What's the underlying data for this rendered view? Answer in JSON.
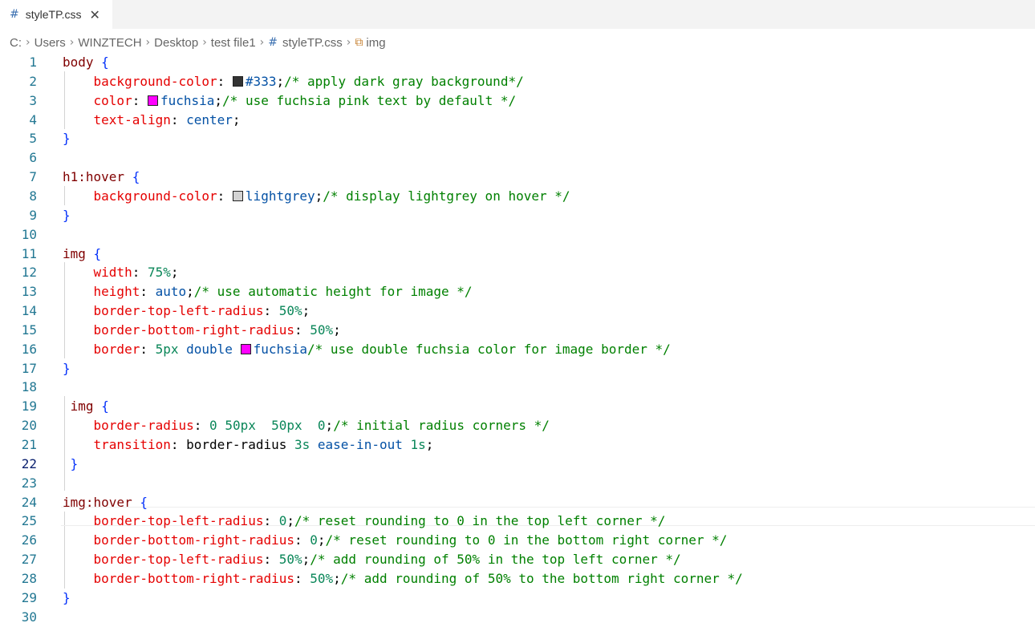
{
  "tab": {
    "icon": "css-hash-icon",
    "label": "styleTP.css"
  },
  "breadcrumb": {
    "items": [
      "C:",
      "Users",
      "WINZTECH",
      "Desktop",
      "test file1",
      "styleTP.css",
      "img"
    ]
  },
  "editor": {
    "active_line": 22,
    "lines": [
      {
        "n": "1",
        "t": [
          [
            "sel",
            "body"
          ],
          [
            "pn",
            " "
          ],
          [
            "br",
            "{"
          ]
        ]
      },
      {
        "n": "2",
        "t": [
          [
            "pn",
            "    "
          ],
          [
            "prop",
            "background-color"
          ],
          [
            "pn",
            ": "
          ],
          [
            "sw",
            "#333333"
          ],
          [
            "val",
            "#333"
          ],
          [
            "pn",
            ";"
          ],
          [
            "cm",
            "/* apply dark gray background*/"
          ]
        ]
      },
      {
        "n": "3",
        "t": [
          [
            "pn",
            "    "
          ],
          [
            "prop",
            "color"
          ],
          [
            "pn",
            ": "
          ],
          [
            "sw",
            "#ff00ff"
          ],
          [
            "val",
            "fuchsia"
          ],
          [
            "pn",
            ";"
          ],
          [
            "cm",
            "/* use fuchsia pink text by default */"
          ]
        ]
      },
      {
        "n": "4",
        "t": [
          [
            "pn",
            "    "
          ],
          [
            "prop",
            "text-align"
          ],
          [
            "pn",
            ": "
          ],
          [
            "val",
            "center"
          ],
          [
            "pn",
            ";"
          ]
        ]
      },
      {
        "n": "5",
        "t": [
          [
            "br",
            "}"
          ]
        ]
      },
      {
        "n": "6",
        "t": []
      },
      {
        "n": "7",
        "t": [
          [
            "sel",
            "h1:hover"
          ],
          [
            "pn",
            " "
          ],
          [
            "br",
            "{"
          ]
        ]
      },
      {
        "n": "8",
        "t": [
          [
            "pn",
            "    "
          ],
          [
            "prop",
            "background-color"
          ],
          [
            "pn",
            ": "
          ],
          [
            "sw",
            "#d3d3d3"
          ],
          [
            "val",
            "lightgrey"
          ],
          [
            "pn",
            ";"
          ],
          [
            "cm",
            "/* display lightgrey on hover */"
          ]
        ]
      },
      {
        "n": "9",
        "t": [
          [
            "br",
            "}"
          ]
        ]
      },
      {
        "n": "10",
        "t": []
      },
      {
        "n": "11",
        "t": [
          [
            "sel",
            "img"
          ],
          [
            "pn",
            " "
          ],
          [
            "br",
            "{"
          ]
        ]
      },
      {
        "n": "12",
        "t": [
          [
            "pn",
            "    "
          ],
          [
            "prop",
            "width"
          ],
          [
            "pn",
            ": "
          ],
          [
            "num",
            "75%"
          ],
          [
            "pn",
            ";"
          ]
        ]
      },
      {
        "n": "13",
        "t": [
          [
            "pn",
            "    "
          ],
          [
            "prop",
            "height"
          ],
          [
            "pn",
            ": "
          ],
          [
            "val",
            "auto"
          ],
          [
            "pn",
            ";"
          ],
          [
            "cm",
            "/* use automatic height for image */"
          ]
        ]
      },
      {
        "n": "14",
        "t": [
          [
            "pn",
            "    "
          ],
          [
            "prop",
            "border-top-left-radius"
          ],
          [
            "pn",
            ": "
          ],
          [
            "num",
            "50%"
          ],
          [
            "pn",
            ";"
          ]
        ]
      },
      {
        "n": "15",
        "t": [
          [
            "pn",
            "    "
          ],
          [
            "prop",
            "border-bottom-right-radius"
          ],
          [
            "pn",
            ": "
          ],
          [
            "num",
            "50%"
          ],
          [
            "pn",
            ";"
          ]
        ]
      },
      {
        "n": "16",
        "t": [
          [
            "pn",
            "    "
          ],
          [
            "prop",
            "border"
          ],
          [
            "pn",
            ": "
          ],
          [
            "num",
            "5px"
          ],
          [
            "pn",
            " "
          ],
          [
            "val",
            "double"
          ],
          [
            "pn",
            " "
          ],
          [
            "sw",
            "#ff00ff"
          ],
          [
            "val",
            "fuchsia"
          ],
          [
            "cm",
            "/* use double fuchsia color for image border */"
          ]
        ]
      },
      {
        "n": "17",
        "t": [
          [
            "br",
            "}"
          ]
        ]
      },
      {
        "n": "18",
        "t": []
      },
      {
        "n": "19",
        "t": [
          [
            "pn",
            " "
          ],
          [
            "sel",
            "img"
          ],
          [
            "pn",
            " "
          ],
          [
            "br",
            "{"
          ]
        ]
      },
      {
        "n": "20",
        "t": [
          [
            "pn",
            "    "
          ],
          [
            "prop",
            "border-radius"
          ],
          [
            "pn",
            ": "
          ],
          [
            "num",
            "0"
          ],
          [
            "pn",
            " "
          ],
          [
            "num",
            "50px"
          ],
          [
            "pn",
            "  "
          ],
          [
            "num",
            "50px"
          ],
          [
            "pn",
            "  "
          ],
          [
            "num",
            "0"
          ],
          [
            "pn",
            ";"
          ],
          [
            "cm",
            "/* initial radius corners */"
          ]
        ]
      },
      {
        "n": "21",
        "t": [
          [
            "pn",
            "    "
          ],
          [
            "prop",
            "transition"
          ],
          [
            "pn",
            ": border-radius "
          ],
          [
            "num",
            "3s"
          ],
          [
            "pn",
            " "
          ],
          [
            "val",
            "ease-in-out"
          ],
          [
            "pn",
            " "
          ],
          [
            "num",
            "1s"
          ],
          [
            "pn",
            ";"
          ]
        ]
      },
      {
        "n": "22",
        "t": [
          [
            "pn",
            " "
          ],
          [
            "br",
            "}"
          ]
        ]
      },
      {
        "n": "23",
        "t": []
      },
      {
        "n": "24",
        "t": [
          [
            "sel",
            "img:hover"
          ],
          [
            "pn",
            " "
          ],
          [
            "br",
            "{"
          ]
        ]
      },
      {
        "n": "25",
        "t": [
          [
            "pn",
            "    "
          ],
          [
            "prop",
            "border-top-left-radius"
          ],
          [
            "pn",
            ": "
          ],
          [
            "num",
            "0"
          ],
          [
            "pn",
            ";"
          ],
          [
            "cm",
            "/* reset rounding to 0 in the top left corner */"
          ]
        ]
      },
      {
        "n": "26",
        "t": [
          [
            "pn",
            "    "
          ],
          [
            "prop",
            "border-bottom-right-radius"
          ],
          [
            "pn",
            ": "
          ],
          [
            "num",
            "0"
          ],
          [
            "pn",
            ";"
          ],
          [
            "cm",
            "/* reset rounding to 0 in the bottom right corner */"
          ]
        ]
      },
      {
        "n": "27",
        "t": [
          [
            "pn",
            "    "
          ],
          [
            "prop",
            "border-top-left-radius"
          ],
          [
            "pn",
            ": "
          ],
          [
            "num",
            "50%"
          ],
          [
            "pn",
            ";"
          ],
          [
            "cm",
            "/* add rounding of 50% in the top left corner */"
          ]
        ]
      },
      {
        "n": "28",
        "t": [
          [
            "pn",
            "    "
          ],
          [
            "prop",
            "border-bottom-right-radius"
          ],
          [
            "pn",
            ": "
          ],
          [
            "num",
            "50%"
          ],
          [
            "pn",
            ";"
          ],
          [
            "cm",
            "/* add rounding of 50% to the bottom right corner */"
          ]
        ]
      },
      {
        "n": "29",
        "t": [
          [
            "br",
            "}"
          ]
        ]
      },
      {
        "n": "30",
        "t": []
      }
    ]
  }
}
